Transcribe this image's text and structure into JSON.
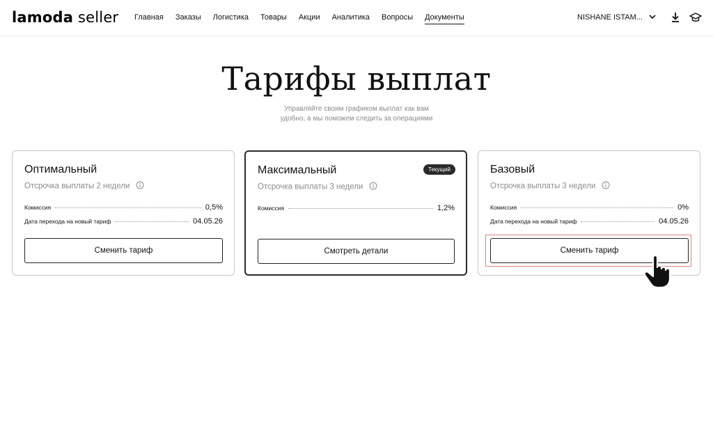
{
  "header": {
    "logo_brand": "lamoda",
    "logo_sub": "seller",
    "nav": [
      {
        "label": "Главная",
        "active": false
      },
      {
        "label": "Заказы",
        "active": false
      },
      {
        "label": "Логистика",
        "active": false
      },
      {
        "label": "Товары",
        "active": false
      },
      {
        "label": "Акции",
        "active": false
      },
      {
        "label": "Аналитика",
        "active": false
      },
      {
        "label": "Вопросы",
        "active": false
      },
      {
        "label": "Документы",
        "active": true
      }
    ],
    "account": "NISHANE ISTAM...",
    "icons": [
      "download-icon",
      "graduation-cap-icon"
    ]
  },
  "page": {
    "title": "Тарифы выплат",
    "subtitle_line1": "Управляйте своим графиком выплат как вам",
    "subtitle_line2": "удобно, а мы поможем следить за операциями"
  },
  "cards": [
    {
      "title": "Оптимальный",
      "delay": "Отсрочка выплаты 2 недели",
      "commission_label": "Комиссия",
      "commission_value": "0,5%",
      "date_label": "Дата перехода на новый тариф",
      "date_value": "04.05.26",
      "button": "Сменить тариф"
    },
    {
      "title": "Максимальный",
      "badge": "Текущий",
      "delay": "Отсрочка выплаты 3 недели",
      "commission_label": "Комиссия",
      "commission_value": "1,2%",
      "button": "Смотреть детали"
    },
    {
      "title": "Базовый",
      "delay": "Отсрочка выплаты 3 недели",
      "commission_label": "Комиссия",
      "commission_value": "0%",
      "date_label": "Дата перехода на новый тариф",
      "date_value": "04.05.26",
      "button": "Сменить тариф"
    }
  ],
  "colors": {
    "text": "#111111",
    "muted": "#8c8c8c",
    "badge_bg": "#2b2b2b",
    "highlight": "#e58080"
  }
}
